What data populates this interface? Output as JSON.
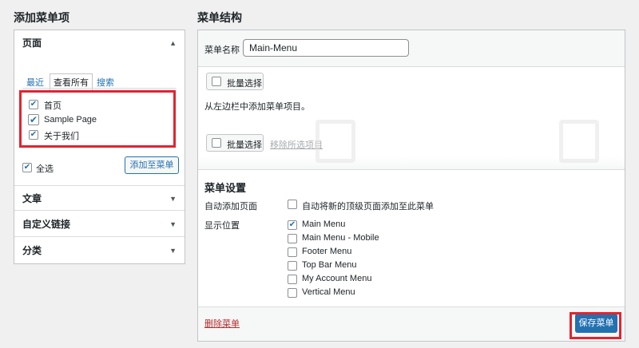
{
  "left": {
    "title": "添加菜单项",
    "pages_section": {
      "title": "页面",
      "tabs": [
        "最近",
        "查看所有",
        "搜索"
      ],
      "items": [
        {
          "label": "首页",
          "checked": true
        },
        {
          "label": "Sample Page",
          "checked": true
        },
        {
          "label": "关于我们",
          "checked": true
        }
      ],
      "select_all_label": "全选",
      "add_button": "添加至菜单"
    },
    "other_sections": [
      "文章",
      "自定义链接",
      "分类"
    ]
  },
  "right": {
    "title": "菜单结构",
    "menu_name_label": "菜单名称",
    "menu_name_value": "Main-Menu",
    "bulk_select_label": "批量选择",
    "empty_hint": "从左边栏中添加菜单项目。",
    "remove_selected_label": "移除所选项目",
    "settings": {
      "title": "菜单设置",
      "auto_add_label": "自动添加页面",
      "auto_add_option": "自动将新的顶级页面添加至此菜单",
      "display_location_label": "显示位置",
      "locations": [
        {
          "label": "Main Menu",
          "checked": true
        },
        {
          "label": "Main Menu - Mobile",
          "checked": false
        },
        {
          "label": "Footer Menu",
          "checked": false
        },
        {
          "label": "Top Bar Menu",
          "checked": false
        },
        {
          "label": "My Account Menu",
          "checked": false
        },
        {
          "label": "Vertical Menu",
          "checked": false
        }
      ]
    },
    "delete_menu_label": "删除菜单",
    "save_menu_label": "保存菜单"
  },
  "icons": {
    "checkmark": "✔",
    "triangle_up": "▲",
    "triangle_down": "▼"
  },
  "colors": {
    "link": "#2271b1",
    "highlight": "#e12430",
    "delete": "#b32d2e"
  }
}
